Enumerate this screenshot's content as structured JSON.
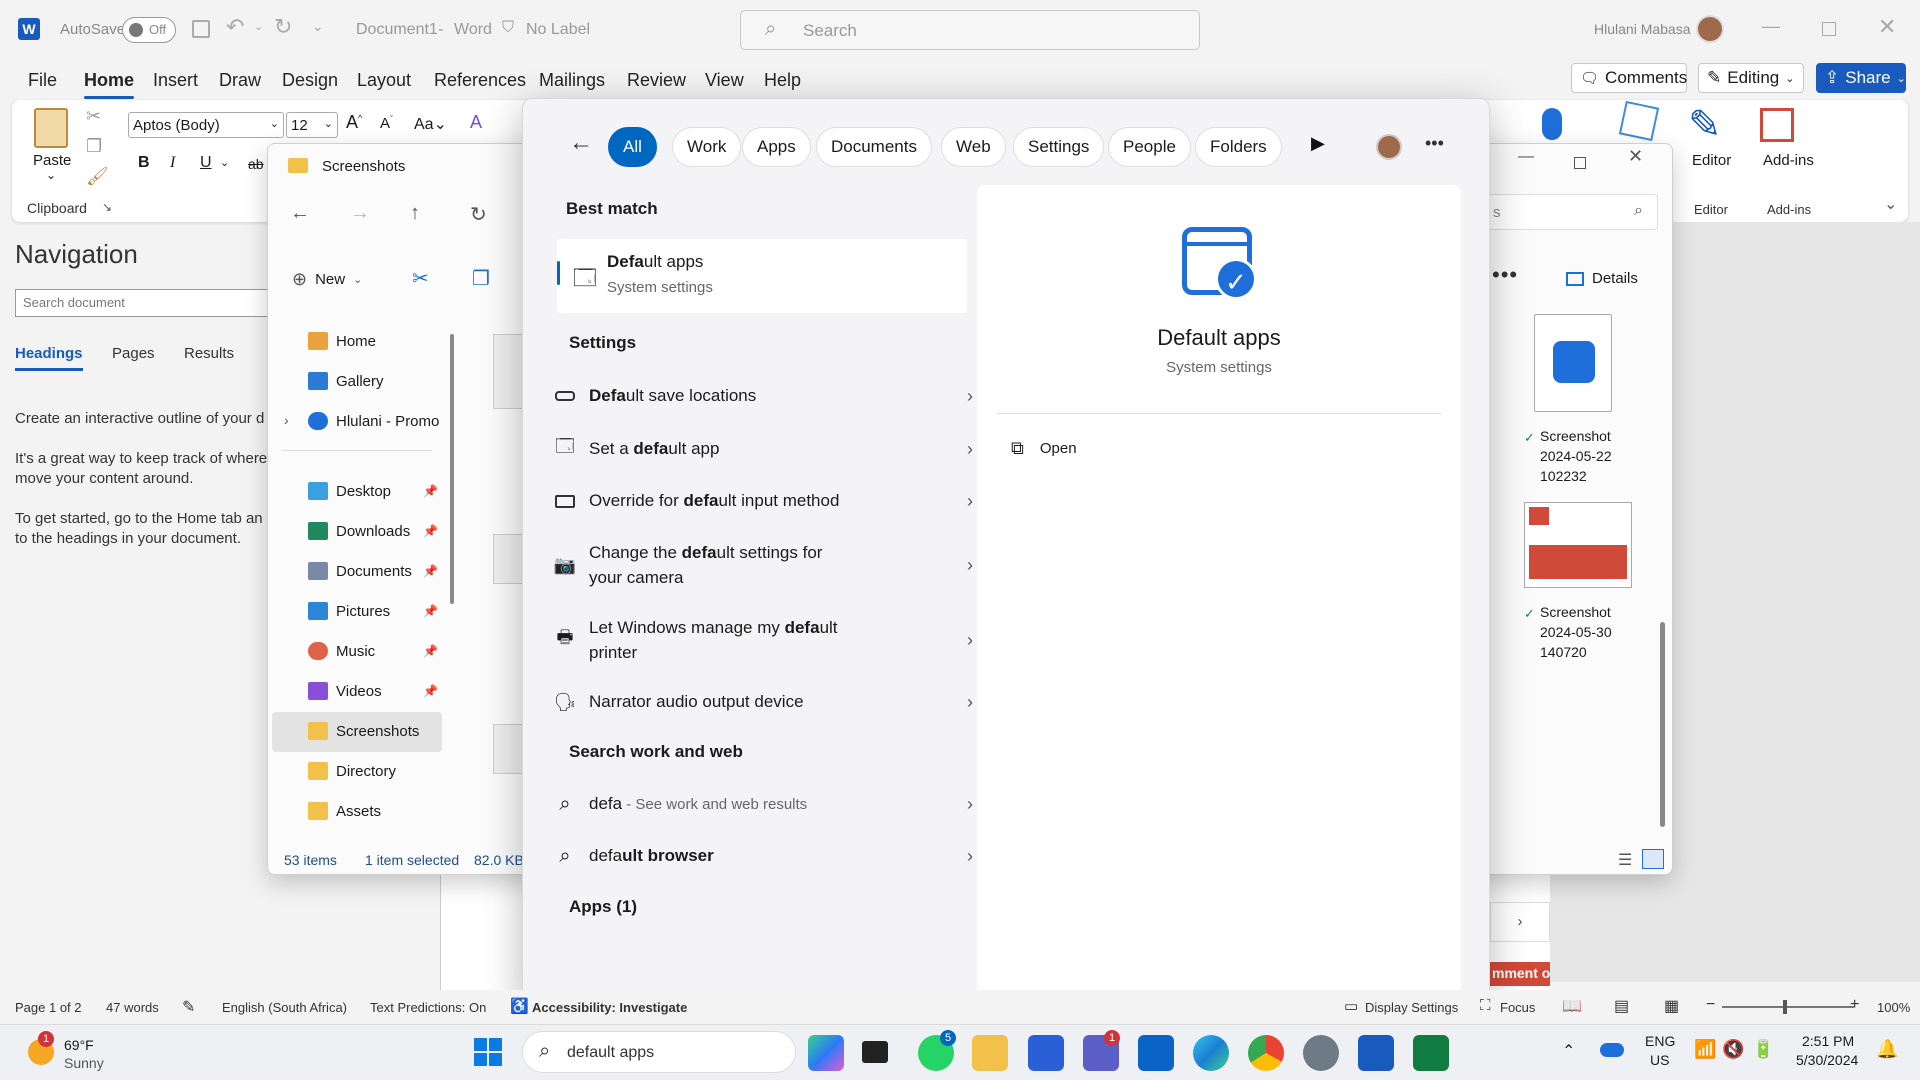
{
  "word": {
    "autosave_label": "AutoSave",
    "autosave_state": "Off",
    "doc_title": "Document1",
    "app_name": "Word",
    "label_status": "No Label",
    "search_placeholder": "Search",
    "user_name": "Hlulani Mabasa",
    "menu": [
      "File",
      "Home",
      "Insert",
      "Draw",
      "Design",
      "Layout",
      "References",
      "Mailings",
      "Review",
      "View",
      "Help"
    ],
    "comments_label": "Comments",
    "editing_label": "Editing",
    "share_label": "Share",
    "ribbon": {
      "paste_label": "Paste",
      "clipboard_label": "Clipboard",
      "font_name": "Aptos (Body)",
      "font_size": "12",
      "editor_label": "Editor",
      "addins_label": "Add-ins",
      "editor_group": "Editor",
      "addins_group": "Add-ins"
    },
    "navigation": {
      "title": "Navigation",
      "search_placeholder": "Search document",
      "tabs": [
        "Headings",
        "Pages",
        "Results"
      ],
      "text1": "Create an interactive outline of your d",
      "text2a": "It's a great way to keep track of where",
      "text2b": "move your content around.",
      "text3a": "To get started, go to the Home tab an",
      "text3b": "to the headings in your document."
    },
    "status": {
      "page": "Page 1 of 2",
      "words": "47 words",
      "language": "English (South Africa)",
      "predictions": "Text Predictions: On",
      "accessibility": "Accessibility: Investigate",
      "display_settings": "Display Settings",
      "focus": "Focus",
      "zoom": "100%"
    },
    "comment_strip": "mment on"
  },
  "explorer": {
    "title": "Screenshots",
    "new_label": "New",
    "details_label": "Details",
    "search_hint": "s",
    "sidebar": [
      {
        "label": "Home",
        "icon": "home-icon",
        "color": "#e8a33d"
      },
      {
        "label": "Gallery",
        "icon": "gallery-icon",
        "color": "#2b7bd4"
      },
      {
        "label": "Hlulani - Promo",
        "icon": "cloud-icon",
        "color": "#1e6fd9"
      },
      {
        "label": "Desktop",
        "icon": "desktop-icon",
        "color": "#3aa0e0"
      },
      {
        "label": "Downloads",
        "icon": "download-icon",
        "color": "#1f8a5f"
      },
      {
        "label": "Documents",
        "icon": "document-icon",
        "color": "#7a8aa6"
      },
      {
        "label": "Pictures",
        "icon": "picture-icon",
        "color": "#2c86d6"
      },
      {
        "label": "Music",
        "icon": "music-icon",
        "color": "#e0624a"
      },
      {
        "label": "Videos",
        "icon": "video-icon",
        "color": "#8a4fd8"
      },
      {
        "label": "Screenshots",
        "icon": "folder-icon",
        "color": "#f2c14a"
      },
      {
        "label": "Directory",
        "icon": "folder-icon",
        "color": "#f2c14a"
      },
      {
        "label": "Assets",
        "icon": "folder-icon",
        "color": "#f2c14a"
      }
    ],
    "items_count": "53 items",
    "selected": "1 item selected",
    "selected_size": "82.0 KB",
    "files": [
      {
        "name1": "Screenshot",
        "name2": "2024-05-22",
        "name3": "102232"
      },
      {
        "name1": "Screenshot",
        "name2": "2024-05-30",
        "name3": "140720"
      }
    ]
  },
  "search": {
    "chips": [
      "All",
      "Work",
      "Apps",
      "Documents",
      "Web",
      "Settings",
      "People",
      "Folders"
    ],
    "best_match_header": "Best match",
    "best_match": {
      "pre": "Defa",
      "post": "ult apps",
      "subtitle": "System settings"
    },
    "settings_header": "Settings",
    "settings": [
      {
        "pre": "",
        "bold": "Defa",
        "post": "ult save locations",
        "icon": "storage-icon"
      },
      {
        "pre": "Set a ",
        "bold": "defa",
        "post": "ult app",
        "icon": "default-apps-icon"
      },
      {
        "pre": "Override for ",
        "bold": "defa",
        "post": "ult input method",
        "icon": "keyboard-icon"
      },
      {
        "pre": "Change the ",
        "bold": "defa",
        "post": "ult settings for",
        "line2": "your camera",
        "icon": "camera-icon"
      },
      {
        "pre": "Let Windows manage my ",
        "bold": "defa",
        "post": "ult",
        "line2": "printer",
        "icon": "printer-icon"
      },
      {
        "pre": "Narrator audio output device",
        "bold": "",
        "post": "",
        "icon": "narrator-icon"
      }
    ],
    "web_header": "Search work and web",
    "web": [
      {
        "bold": "defa",
        "rest": " - See work and web results"
      },
      {
        "bold": "default browser",
        "rest": ""
      }
    ],
    "apps_header": "Apps (1)",
    "preview": {
      "title": "Default apps",
      "subtitle": "System settings",
      "open_label": "Open"
    },
    "query": "default apps"
  },
  "taskbar": {
    "temp": "69°F",
    "condition": "Sunny",
    "weather_badge": "1",
    "whatsapp_badge": "5",
    "teams_badge": "1",
    "lang1": "ENG",
    "lang2": "US",
    "time": "2:51 PM",
    "date": "5/30/2024"
  },
  "colors": {
    "accent": "#0067c0",
    "word_blue": "#185abd"
  }
}
